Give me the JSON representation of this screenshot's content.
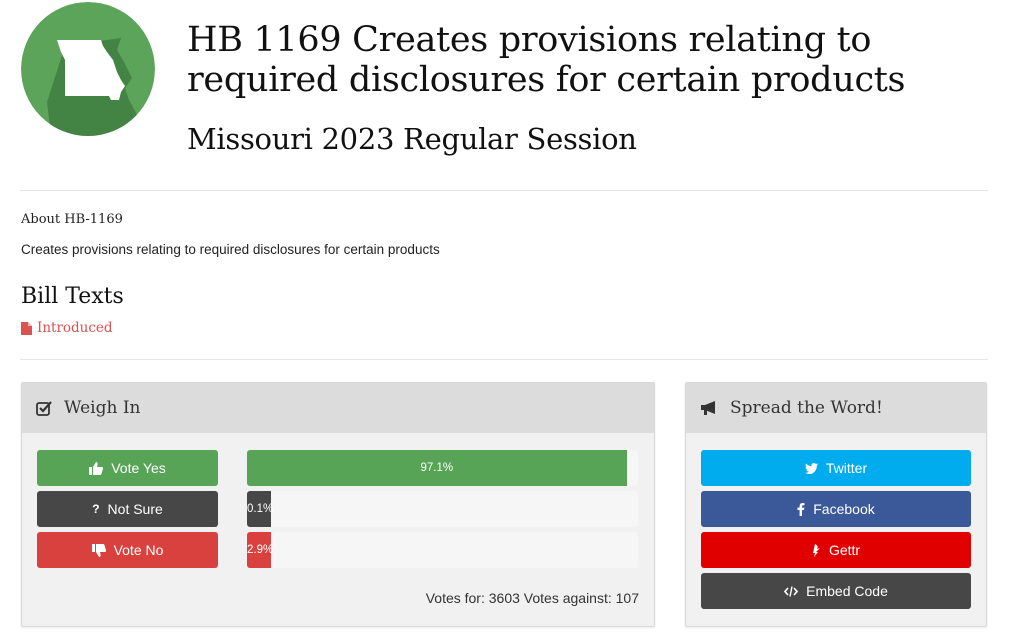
{
  "header": {
    "title": "HB 1169 Creates provisions relating to required disclosures for certain products",
    "session": "Missouri 2023 Regular Session"
  },
  "about": {
    "heading": "About HB-1169",
    "text": "Creates provisions relating to required disclosures for certain products"
  },
  "bill_texts": {
    "heading": "Bill Texts",
    "link": "Introduced",
    "icon": "document-icon"
  },
  "weigh_in": {
    "heading": "Weigh In",
    "icon": "checkbox-icon",
    "options": [
      {
        "label": "Vote Yes",
        "icon": "thumbs-up-icon",
        "color": "#57a457",
        "percent_label": "97.1%",
        "percent": 97.1,
        "bar_color": "#57a457"
      },
      {
        "label": "Not Sure",
        "icon": "question-icon",
        "color": "#474747",
        "percent_label": "0.1%",
        "percent": 0.1,
        "bar_color": "#474747"
      },
      {
        "label": "Vote No",
        "icon": "thumbs-down-icon",
        "color": "#d9413e",
        "percent_label": "2.9%",
        "percent": 2.9,
        "bar_color": "#d9413e"
      }
    ],
    "votes_summary": "Votes for: 3603 Votes against: 107"
  },
  "spread": {
    "heading": "Spread the Word!",
    "icon": "megaphone-icon",
    "buttons": [
      {
        "label": "Twitter",
        "icon": "twitter-icon",
        "color": "#00acee"
      },
      {
        "label": "Facebook",
        "icon": "facebook-icon",
        "color": "#3b5998"
      },
      {
        "label": "Gettr",
        "icon": "gettr-icon",
        "color": "#e10000"
      },
      {
        "label": "Embed Code",
        "icon": "code-icon",
        "color": "#474747"
      }
    ]
  },
  "colors": {
    "accent_green": "#57a457",
    "link_red": "#d9534f"
  }
}
